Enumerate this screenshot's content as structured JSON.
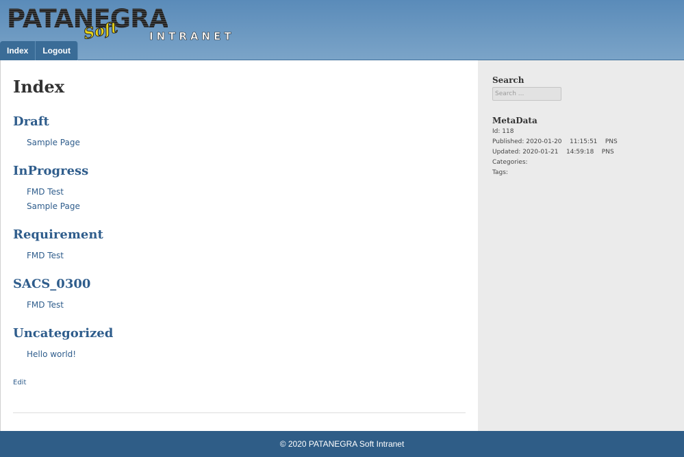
{
  "header": {
    "logo_main": "PATANEGRA",
    "logo_soft": "Soft",
    "logo_sub": "INTRANET"
  },
  "nav": {
    "items": [
      {
        "label": "Index"
      },
      {
        "label": "Logout"
      }
    ]
  },
  "main": {
    "title": "Index",
    "categories": [
      {
        "heading": "Draft",
        "links": [
          "Sample Page"
        ]
      },
      {
        "heading": "InProgress",
        "links": [
          "FMD Test",
          "Sample Page"
        ]
      },
      {
        "heading": "Requirement",
        "links": [
          "FMD Test"
        ]
      },
      {
        "heading": "SACS_0300",
        "links": [
          "FMD Test"
        ]
      },
      {
        "heading": "Uncategorized",
        "links": [
          "Hello world!"
        ]
      }
    ],
    "edit_label": "Edit"
  },
  "sidebar": {
    "search_heading": "Search",
    "search_placeholder": "Search ...",
    "meta_heading": "MetaData",
    "meta_lines": [
      "Id: 118",
      "Published: 2020-01-20    11:15:51    PNS",
      "Updated: 2020-01-21    14:59:18    PNS",
      "Categories:",
      "Tags:"
    ]
  },
  "footer": {
    "text": "© 2020 PATANEGRA Soft Intranet"
  },
  "colors": {
    "header_bg": "#6a98c2",
    "nav_bg": "#3a6c97",
    "link": "#2f5d8c",
    "footer_bg": "#2f5d87",
    "sidebar_bg": "#ebebeb"
  }
}
